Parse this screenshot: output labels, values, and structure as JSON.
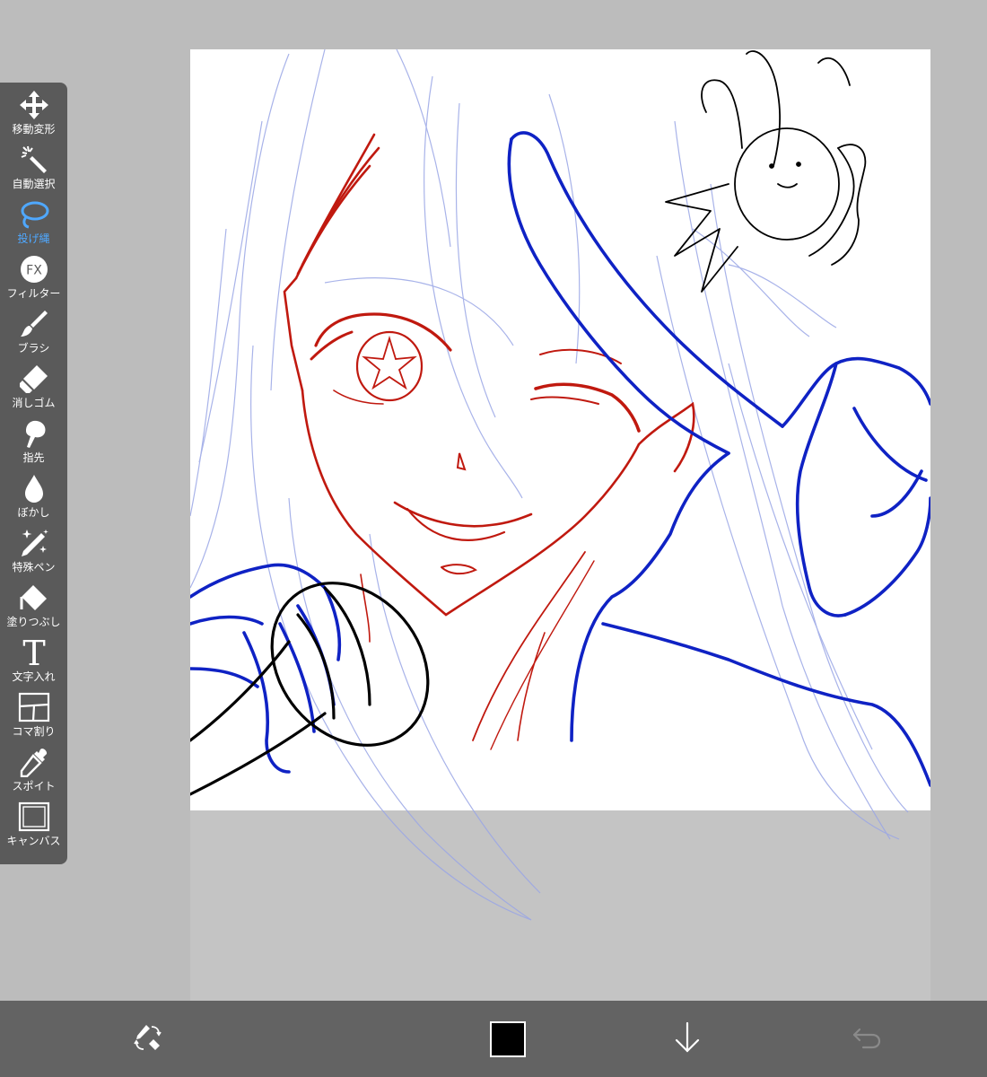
{
  "toolbar": {
    "tools": [
      {
        "label": "移動変形",
        "icon": "move-arrows-icon"
      },
      {
        "label": "自動選択",
        "icon": "magic-wand-icon"
      },
      {
        "label": "投げ縄",
        "icon": "lasso-icon",
        "active": true
      },
      {
        "label": "フィルター",
        "icon": "fx-filter-icon"
      },
      {
        "label": "ブラシ",
        "icon": "brush-icon"
      },
      {
        "label": "消しゴム",
        "icon": "eraser-icon"
      },
      {
        "label": "指先",
        "icon": "finger-smudge-icon"
      },
      {
        "label": "ぼかし",
        "icon": "blur-drop-icon"
      },
      {
        "label": "特殊ペン",
        "icon": "special-pen-icon"
      },
      {
        "label": "塗りつぶし",
        "icon": "paint-bucket-icon"
      },
      {
        "label": "文字入れ",
        "icon": "text-t-icon"
      },
      {
        "label": "コマ割り",
        "icon": "panel-divide-icon"
      },
      {
        "label": "スポイト",
        "icon": "eyedropper-icon"
      },
      {
        "label": "キャンバス",
        "icon": "canvas-frame-icon"
      }
    ],
    "fx_text": "FX",
    "text_tool_glyph": "T"
  },
  "bottombar": {
    "pen_eraser_toggle_icon": "pen-eraser-swap-icon",
    "current_color": "#000000",
    "layer_down_icon": "arrow-down-icon",
    "undo_icon": "undo-arrow-icon"
  },
  "colors": {
    "accent": "#4fa8ff",
    "toolbar_bg": "#5a5a5a",
    "bottombar_bg": "#636363",
    "background": "#bcbcbc",
    "sketch_red": "#c0190f",
    "sketch_blue": "#0f22c4",
    "sketch_light_blue": "#9aa6e6"
  }
}
